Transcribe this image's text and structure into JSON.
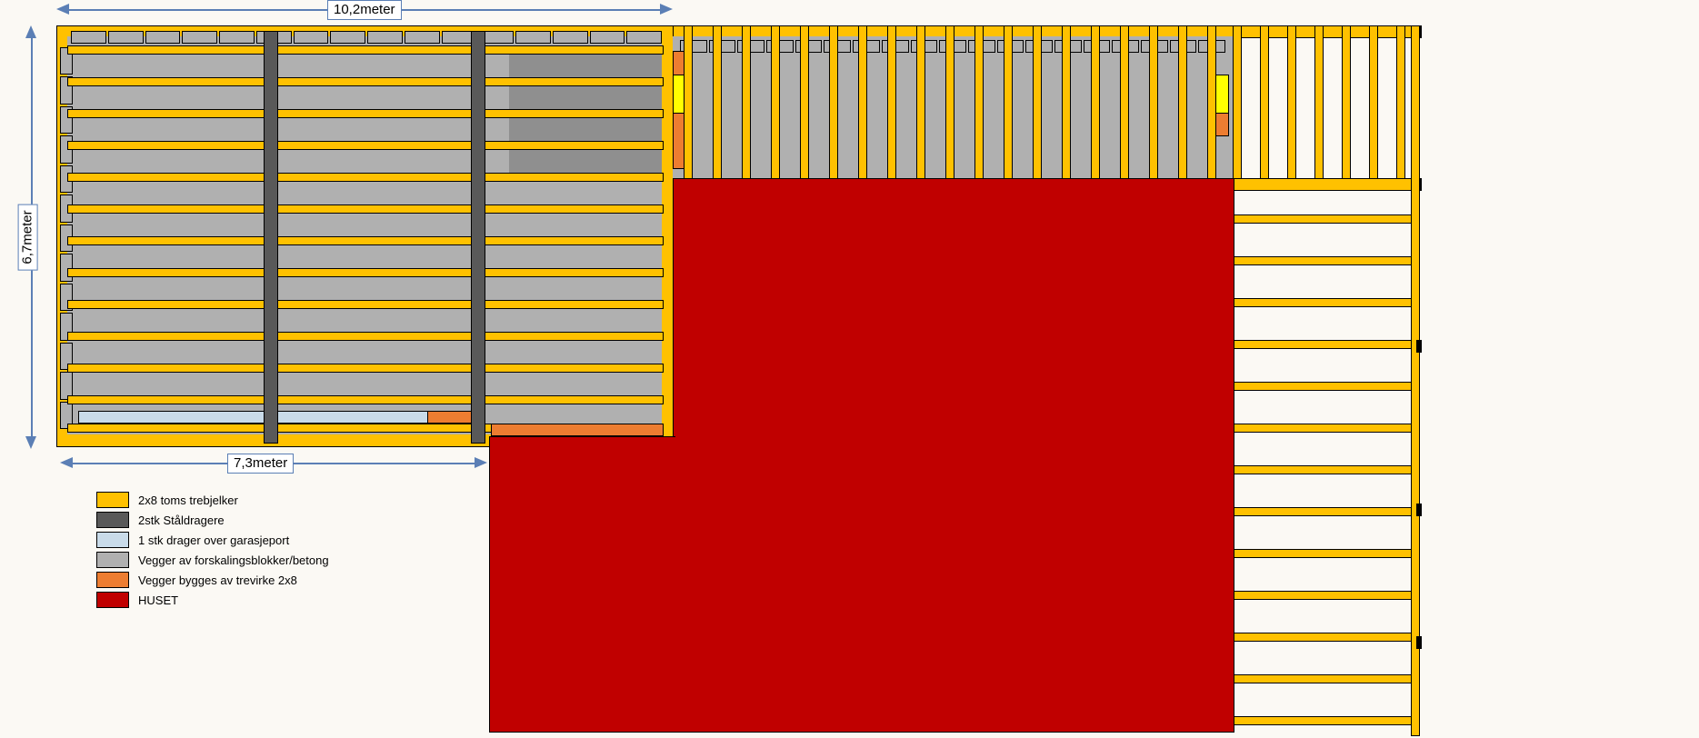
{
  "dimensions": {
    "top_width": "10,2meter",
    "left_height": "6,7meter",
    "bottom_width": "7,3meter"
  },
  "legend": {
    "items": [
      {
        "label": "2x8 toms trebjelker"
      },
      {
        "label": "2stk Ståldragere"
      },
      {
        "label": "1 stk drager over garasjeport"
      },
      {
        "label": "Vegger av forskalingsblokker/betong"
      },
      {
        "label": "Vegger bygges av trevirke 2x8"
      },
      {
        "label": "HUSET"
      }
    ]
  },
  "colors": {
    "trebjelker_2x8": "#ffc100",
    "staldragere": "#595959",
    "drager_garasjeport": "#c9dbe9",
    "vegger_betong": "#b0b0b0",
    "vegger_trevirke": "#ed7d31",
    "huset": "#c00000"
  },
  "structure": {
    "garage": {
      "horizontal_joists": 13,
      "vertical_steel_beams": 2,
      "top_wall_has_blocks": true,
      "left_wall_has_blocks": true,
      "bottom_front_has_garage_door_header": true
    },
    "connector_wall": {
      "top_gray_band_with_studs": true,
      "orange_wood_segment_left": true,
      "orange_wood_segment_right": true,
      "yellow_highlight_left": true,
      "yellow_highlight_right": true
    },
    "right_deck": {
      "vertical_studs_top": true,
      "horizontal_joists_bottom": 13
    },
    "house_block": true
  }
}
